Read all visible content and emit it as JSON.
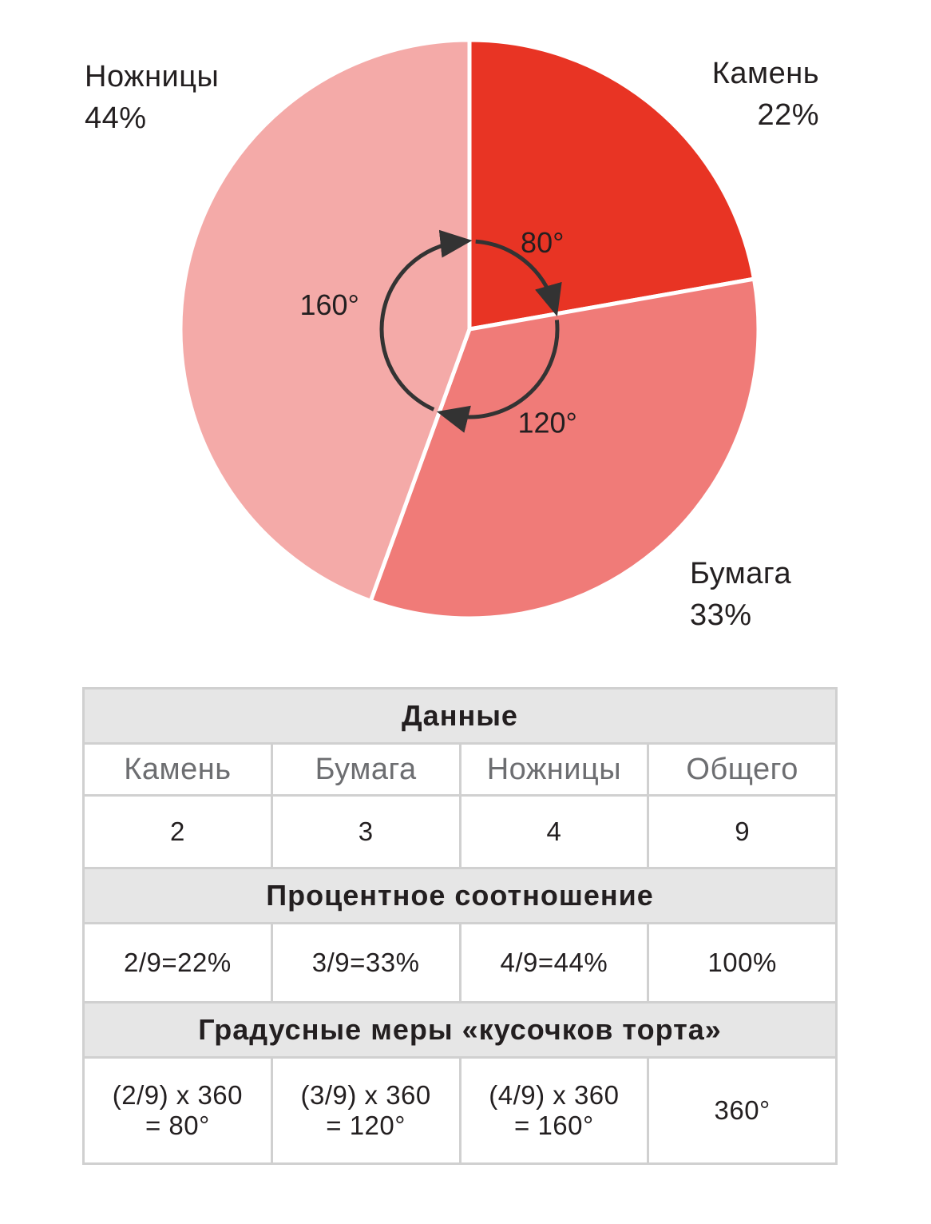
{
  "chart_data": {
    "type": "pie",
    "slices": [
      {
        "label": "Камень",
        "percent_text": "22%",
        "value": 2,
        "angle": 80,
        "angle_text": "80°",
        "color": "#e83424"
      },
      {
        "label": "Бумага",
        "percent_text": "33%",
        "value": 3,
        "angle": 120,
        "angle_text": "120°",
        "color": "#f07b78"
      },
      {
        "label": "Ножницы",
        "percent_text": "44%",
        "value": 4,
        "angle": 160,
        "angle_text": "160°",
        "color": "#f4aaa8"
      }
    ],
    "start_angle_deg_from_top": 0,
    "direction": "clockwise"
  },
  "table": {
    "sections": {
      "data": "Данные",
      "percent": "Процентное соотношение",
      "degrees": "Градусные меры «кусочков торта»"
    },
    "columns": [
      "Камень",
      "Бумага",
      "Ножницы",
      "Общего"
    ],
    "counts": [
      "2",
      "3",
      "4",
      "9"
    ],
    "percents": [
      "2/9=22%",
      "3/9=33%",
      "4/9=44%",
      "100%"
    ],
    "formulas": [
      {
        "line1": "(2/9) x 360",
        "line2": "= 80°"
      },
      {
        "line1": "(3/9) x 360",
        "line2": "= 120°"
      },
      {
        "line1": "(4/9) x 360",
        "line2": "= 160°"
      },
      {
        "line1": "360°",
        "line2": ""
      }
    ]
  },
  "colors": {
    "table_border": "#d0d0d0",
    "section_fill": "#e6e6e6",
    "arrow": "#333333"
  }
}
